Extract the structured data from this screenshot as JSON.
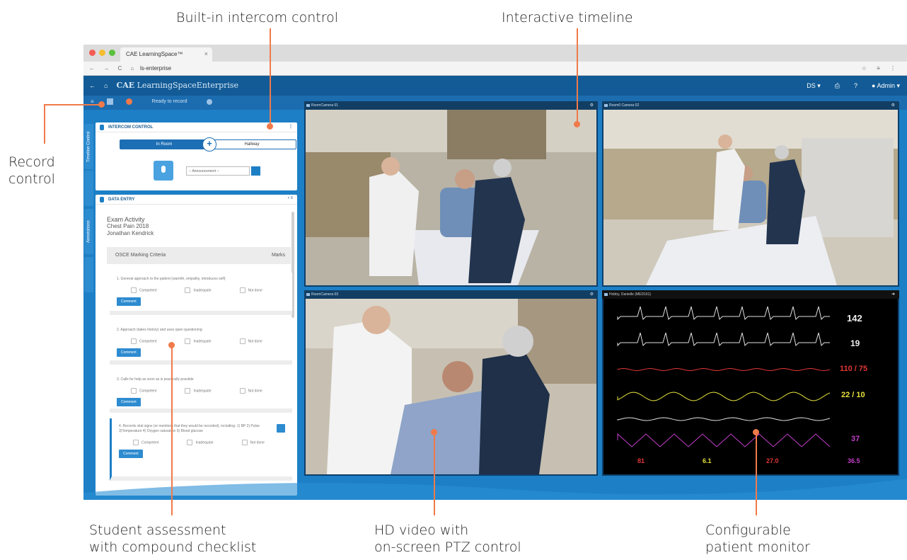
{
  "callouts": {
    "intercom": "Built-in intercom control",
    "timeline": "Interactive timeline",
    "record_line1": "Record",
    "record_line2": "control",
    "assessment_line1": "Student assessment",
    "assessment_line2": "with compound checklist",
    "video_line1": "HD video with",
    "video_line2": "on-screen PTZ control",
    "monitor_line1": "Configurable",
    "monitor_line2": "patient monitor"
  },
  "browser": {
    "tab_title": "CAE LearningSpace™",
    "url": "ls-enterprise"
  },
  "app": {
    "brand_cae": "CAE",
    "brand_name": "LearningSpaceEnterprise",
    "user": "Admin",
    "help": "?",
    "site": "DS"
  },
  "toolbar": {
    "ready": "Ready to record"
  },
  "sidetabs": [
    "Timeline Control",
    "Annotations"
  ],
  "intercom": {
    "title": "INTERCOM CONTROL",
    "toggle_left": "In Room",
    "toggle_right": "Hallway",
    "select": "-- Announcement --"
  },
  "data_entry": {
    "title": "DATA ENTRY",
    "activity": "Exam Activity",
    "case": "Chest Pain 2018",
    "student": "Jonathan Kendrick",
    "criteria": "OSCE Marking Criteria",
    "marks": "Marks",
    "options": [
      "Competent",
      "Inadequate",
      "Not done"
    ],
    "comment": "Comment",
    "questions": [
      "1. General approach to the patient (warmth, empathy, introduces self)",
      "2. Approach (takes history) and uses open questioning",
      "3. Calls for help as soon as is practically possible",
      "4. Records vital signs (or mentions that they would be recorded), including: 1) BP 2) Pulse 3)Temperature 4) Oxygen saturation 5) Blood glucose"
    ]
  },
  "videos": [
    {
      "label": "RoomCamera 01"
    },
    {
      "label": "Room0 Camera 02"
    },
    {
      "label": "RoomCamera 03"
    }
  ],
  "monitor": {
    "title": "Hobby, Danielle (MED161)",
    "hr": "142",
    "spo2": "19",
    "bp": "110 / 75",
    "pap": "22 / 10",
    "resp": "37",
    "bottom": [
      "81",
      "6.1",
      "27.0",
      "36.5"
    ],
    "colors": {
      "ecg": "#e0e0e0",
      "bp": "#e33636",
      "pap": "#e6e13c",
      "resp": "#c23ec9"
    }
  }
}
